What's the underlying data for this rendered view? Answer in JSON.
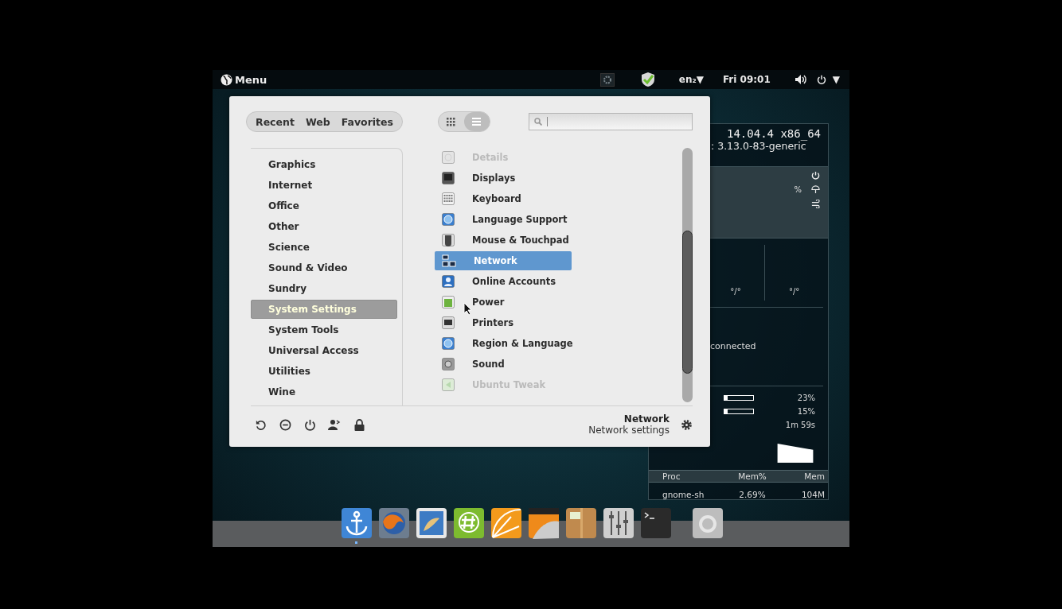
{
  "top_bar": {
    "menu_label": "Menu",
    "keyboard_layout": "en₂",
    "keyboard_arrow": "▼",
    "clock": "Fri 09:01",
    "system_arrow": "▼"
  },
  "menu": {
    "tabs": [
      "Recent",
      "Web",
      "Favorites"
    ],
    "view_modes": [
      {
        "kind": "grid",
        "selected": false
      },
      {
        "kind": "list",
        "selected": true
      }
    ],
    "categories": [
      {
        "label": "Graphics",
        "selected": false
      },
      {
        "label": "Internet",
        "selected": false
      },
      {
        "label": "Office",
        "selected": false
      },
      {
        "label": "Other",
        "selected": false
      },
      {
        "label": "Science",
        "selected": false
      },
      {
        "label": "Sound & Video",
        "selected": false
      },
      {
        "label": "Sundry",
        "selected": false
      },
      {
        "label": "System Settings",
        "selected": true
      },
      {
        "label": "System Tools",
        "selected": false
      },
      {
        "label": "Universal Access",
        "selected": false
      },
      {
        "label": "Utilities",
        "selected": false
      },
      {
        "label": "Wine",
        "selected": false
      }
    ],
    "apps": [
      {
        "label": "Details",
        "kind": "details",
        "selected": false,
        "faded": true
      },
      {
        "label": "Displays",
        "kind": "display",
        "selected": false,
        "faded": false
      },
      {
        "label": "Keyboard",
        "kind": "keyboard",
        "selected": false,
        "faded": false
      },
      {
        "label": "Language Support",
        "kind": "globe",
        "selected": false,
        "faded": false
      },
      {
        "label": "Mouse & Touchpad",
        "kind": "mouse",
        "selected": false,
        "faded": false
      },
      {
        "label": "Network",
        "kind": "network",
        "selected": true,
        "faded": false
      },
      {
        "label": "Online Accounts",
        "kind": "account",
        "selected": false,
        "faded": false
      },
      {
        "label": "Power",
        "kind": "battery",
        "selected": false,
        "faded": false
      },
      {
        "label": "Printers",
        "kind": "printer",
        "selected": false,
        "faded": false
      },
      {
        "label": "Region & Language",
        "kind": "globe",
        "selected": false,
        "faded": false
      },
      {
        "label": "Sound",
        "kind": "speaker",
        "selected": false,
        "faded": false
      },
      {
        "label": "Ubuntu Tweak",
        "kind": "tweak",
        "selected": false,
        "faded": true
      }
    ],
    "actions": [
      {
        "kind": "restart"
      },
      {
        "kind": "logout"
      },
      {
        "kind": "power"
      },
      {
        "kind": "switch-user"
      },
      {
        "kind": "lock"
      }
    ],
    "info": {
      "title": "Network",
      "subtitle": "Network settings"
    }
  },
  "widget": {
    "os": "14.04.4 x86_64",
    "kernel": ": 3.13.0-83-generic",
    "humidity": "%",
    "cpu_readings": [
      "°/°",
      "°/°"
    ],
    "network_status": "connected",
    "meters": [
      {
        "level": 0.12,
        "reading": "23%"
      },
      {
        "level": 0.1,
        "reading": "15%"
      }
    ],
    "uptime": "1m 59s",
    "table": {
      "columns": [
        "Proc",
        "Mem%",
        "Mem"
      ],
      "rows": [
        [
          "gnome-sh",
          "2.69%",
          "104M"
        ]
      ]
    }
  },
  "dock": [
    {
      "kind": "anchor",
      "running": true
    },
    {
      "kind": "browser",
      "running": false
    },
    {
      "kind": "mail",
      "running": false
    },
    {
      "kind": "chat",
      "running": false
    },
    {
      "kind": "citrus",
      "running": false
    },
    {
      "kind": "video",
      "running": false
    },
    {
      "kind": "archive",
      "running": false
    },
    {
      "kind": "mixer",
      "running": false
    },
    {
      "kind": "terminal",
      "running": false
    },
    {
      "kind": "trash",
      "running": false
    }
  ]
}
